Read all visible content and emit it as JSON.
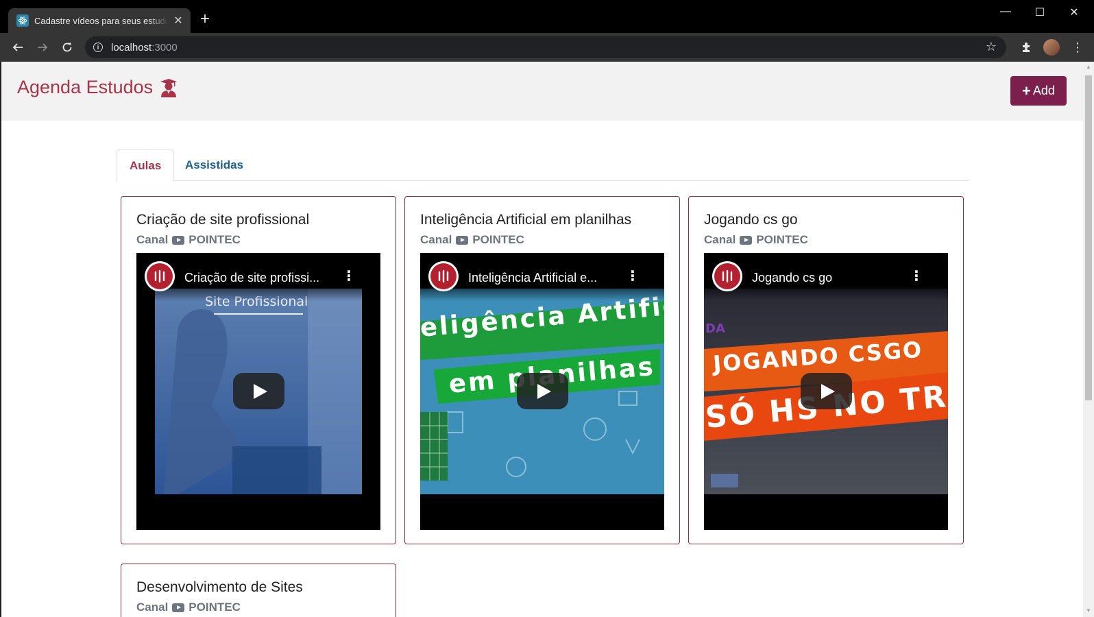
{
  "browser": {
    "tab_title": "Cadastre vídeos para seus estudos",
    "url_host": "localhost",
    "url_port": ":3000"
  },
  "header": {
    "title": "Agenda Estudos",
    "add_label": "Add"
  },
  "tabs": [
    {
      "label": "Aulas",
      "active": true
    },
    {
      "label": "Assistidas",
      "active": false
    }
  ],
  "cards": [
    {
      "title": "Criação de site profissional",
      "channel_prefix": "Canal",
      "channel_name": "POINTEC",
      "video_title": "Criação de site profissi...",
      "thumb_text": "Site Profissional"
    },
    {
      "title": "Inteligência Artificial em planilhas",
      "channel_prefix": "Canal",
      "channel_name": "POINTEC",
      "video_title": "Inteligência Artificial e...",
      "thumb_text_1": "eligência Artific",
      "thumb_text_2": "em planilhas"
    },
    {
      "title": "Jogando cs go",
      "channel_prefix": "Canal",
      "channel_name": "POINTEC",
      "video_title": "Jogando cs go",
      "thumb_text_1": "JOGANDO CSGO",
      "thumb_text_2": "SÓ HS NO TR"
    },
    {
      "title": "Desenvolvimento de Sites",
      "channel_prefix": "Canal",
      "channel_name": "POINTEC"
    }
  ],
  "colors": {
    "brand": "#a8344a",
    "add_button": "#7b1f4c",
    "card_border": "#8b2a40",
    "tab_inactive": "#1f5f8e"
  }
}
